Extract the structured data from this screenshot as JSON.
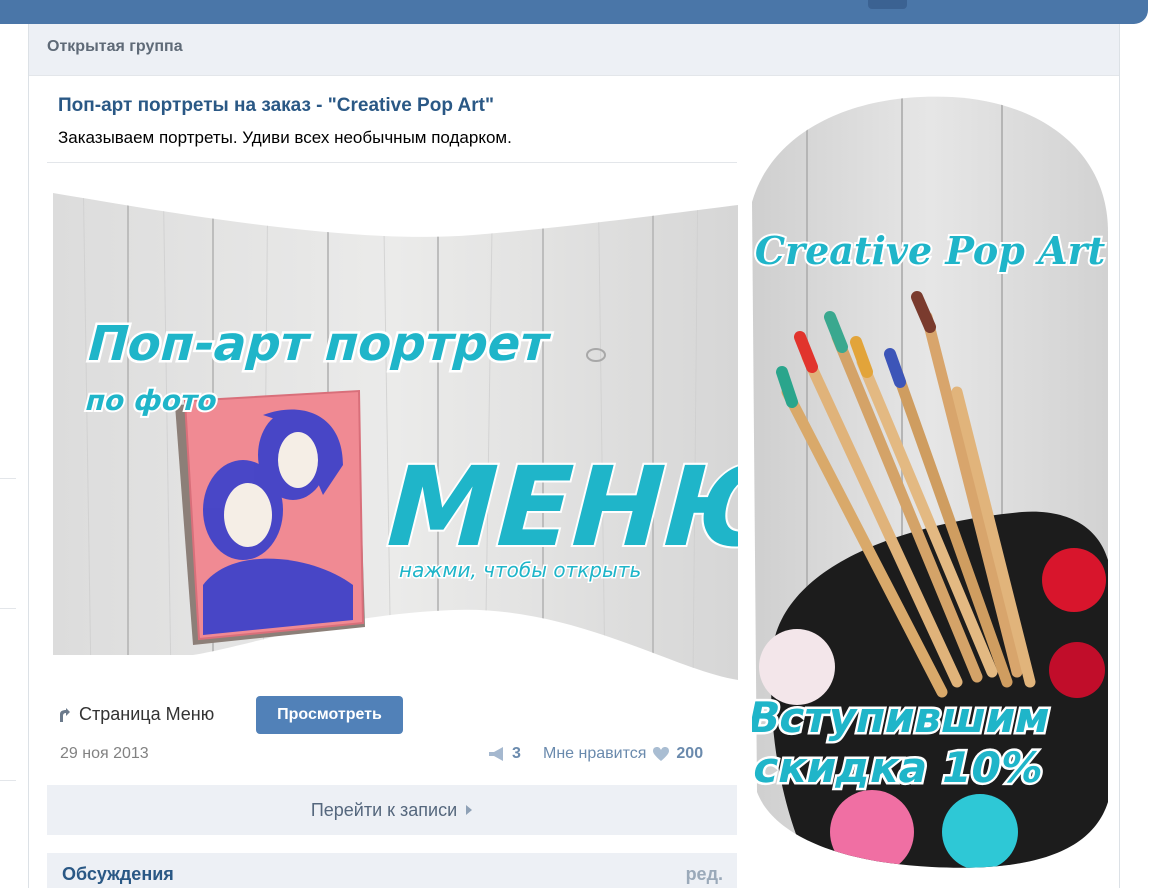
{
  "group_type": "Открытая группа",
  "post": {
    "title": "Поп-арт портреты на заказ - \"Creative Pop Art\"",
    "description": "Заказываем портреты. Удиви всех необычным подарком."
  },
  "banner": {
    "headline_1": "Поп-арт портрет",
    "headline_2": "по фото",
    "menu_title": "МЕНЮ",
    "menu_hint": "нажми, чтобы открыть"
  },
  "side_banner": {
    "brand": "Creative Pop Art",
    "promo_line_1": "Вступившим",
    "promo_line_2": "скидка 10%"
  },
  "page_link": {
    "label": "Страница Меню",
    "button": "Просмотреть"
  },
  "meta": {
    "date": "29 ноя 2013",
    "reposts": "3",
    "likes_label": "Мне нравится",
    "likes_count": "200"
  },
  "goto_label": "Перейти к записи",
  "discussions": {
    "title": "Обсуждения",
    "edit": "ред."
  },
  "colors": {
    "accent": "#5181b8",
    "header_bar": "#4a76a8",
    "link": "#2a5885",
    "banner_cyan": "#1fb5c9"
  }
}
